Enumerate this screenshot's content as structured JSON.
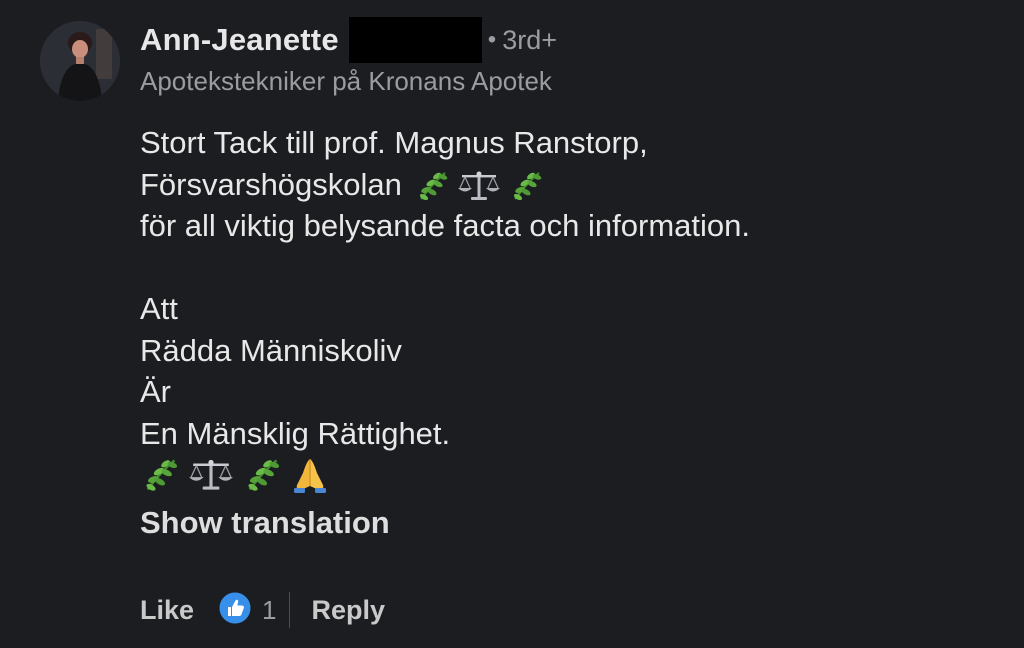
{
  "author": {
    "name": "Ann-Jeanette",
    "connection_degree": "3rd+",
    "separator": "•",
    "headline": "Apotekstekniker på Kronans Apotek"
  },
  "comment": {
    "line1": "Stort Tack till prof. Magnus Ranstorp,",
    "line2": "Försvarshögskolan",
    "line2_emojis": [
      "herb-icon",
      "balance-scale-icon",
      "herb-icon"
    ],
    "line3": "för all viktig belysande facta och information.",
    "line4": "Att",
    "line5": "Rädda Människoliv",
    "line6": "Är",
    "line7": "En Mänsklig Rättighet.",
    "final_emojis": [
      "herb-icon",
      "balance-scale-icon",
      "herb-icon",
      "folded-hands-icon"
    ]
  },
  "show_translation_label": "Show translation",
  "actions": {
    "like_label": "Like",
    "like_count": "1",
    "reply_label": "Reply"
  },
  "colors": {
    "background": "#1c1d21",
    "like_badge": "#378fe9",
    "herb": "#57a53a"
  }
}
